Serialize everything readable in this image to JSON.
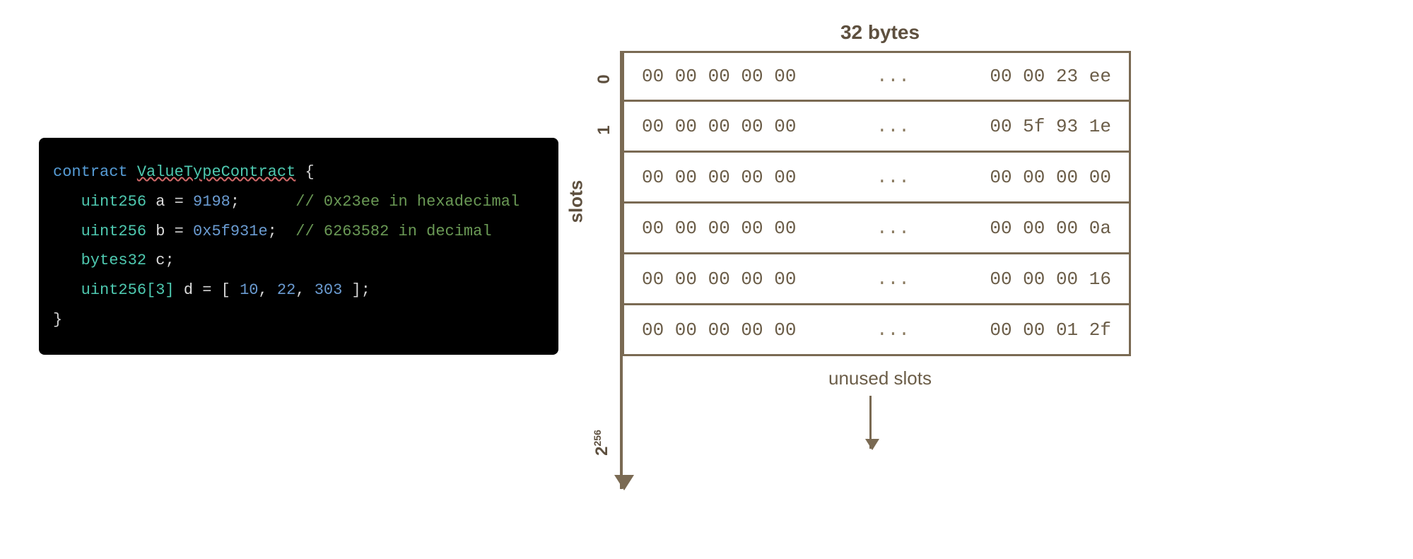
{
  "code": {
    "keyword_contract": "contract",
    "contract_name": "ValueTypeContract",
    "brace_open": "{",
    "brace_close": "}",
    "lines": {
      "a": {
        "type": "uint256",
        "name": "a",
        "eq": "=",
        "value": "9198",
        "semi": ";",
        "comment": "// 0x23ee in hexadecimal"
      },
      "b": {
        "type": "uint256",
        "name": "b",
        "eq": "=",
        "value": "0x5f931e",
        "semi": ";",
        "comment": "// 6263582 in decimal"
      },
      "c": {
        "type": "bytes32",
        "name": "c",
        "semi": ";"
      },
      "d": {
        "type": "uint256[3]",
        "name": "d",
        "eq": "=",
        "open": "[",
        "v1": "10",
        "comma1": ",",
        "v2": "22",
        "comma2": ",",
        "v3": "303",
        "close": "]",
        "semi": ";"
      }
    }
  },
  "diagram": {
    "bytes_label": "32 bytes",
    "slots_label": "slots",
    "unused_label": "unused slots",
    "max_label_base": "2",
    "max_label_exp": "256",
    "index0": "0",
    "index1": "1",
    "rows": [
      {
        "left": "00 00 00 00 00",
        "mid": "...",
        "right": "00 00 23 ee"
      },
      {
        "left": "00 00 00 00 00",
        "mid": "...",
        "right": "00 5f 93 1e"
      },
      {
        "left": "00 00 00 00 00",
        "mid": "...",
        "right": "00 00 00 00"
      },
      {
        "left": "00 00 00 00 00",
        "mid": "...",
        "right": "00 00 00 0a"
      },
      {
        "left": "00 00 00 00 00",
        "mid": "...",
        "right": "00 00 00 16"
      },
      {
        "left": "00 00 00 00 00",
        "mid": "...",
        "right": "00 00 01 2f"
      }
    ]
  },
  "chart_data": {
    "type": "table",
    "title": "Solidity storage slot layout (32 bytes per slot)",
    "slot_width_bytes": 32,
    "total_slots": "2^256",
    "variables": [
      {
        "name": "a",
        "type": "uint256",
        "decimal": 9198,
        "hex": "0x23ee",
        "slot": 0
      },
      {
        "name": "b",
        "type": "uint256",
        "decimal": 6263582,
        "hex": "0x5f931e",
        "slot": 1
      },
      {
        "name": "c",
        "type": "bytes32",
        "hex": "0x00",
        "slot": 2
      },
      {
        "name": "d[0]",
        "type": "uint256",
        "decimal": 10,
        "hex": "0x0a",
        "slot": 3
      },
      {
        "name": "d[1]",
        "type": "uint256",
        "decimal": 22,
        "hex": "0x16",
        "slot": 4
      },
      {
        "name": "d[2]",
        "type": "uint256",
        "decimal": 303,
        "hex": "0x012f",
        "slot": 5
      }
    ],
    "slots_hex_tail": [
      "00 00 23 ee",
      "00 5f 93 1e",
      "00 00 00 00",
      "00 00 00 0a",
      "00 00 00 16",
      "00 00 01 2f"
    ]
  }
}
